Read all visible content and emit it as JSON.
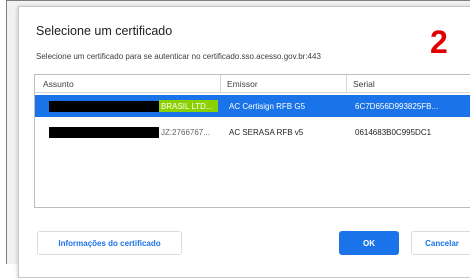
{
  "dialog": {
    "title": "Selecione um certificado",
    "subtitle": "Selecione um certificado para se autenticar no certificado.sso.acesso.gov.br:443",
    "step_number": "2"
  },
  "table": {
    "headers": [
      "Assunto",
      "Emissor",
      "Serial"
    ],
    "rows": [
      {
        "subject": "BRASIL LTD...",
        "issuer": "AC Certisign RFB G5",
        "serial": "6C7D656D993825FB...",
        "selected": true
      },
      {
        "subject": "JZ:2766767...",
        "issuer": "AC SERASA RFB v5",
        "serial": "0614683B0C995DC1",
        "selected": false
      }
    ]
  },
  "buttons": {
    "info": "Informações do certificado",
    "ok": "OK",
    "cancel": "Cancelar"
  },
  "colors": {
    "accent": "#1a73e8",
    "step_number": "#e00000",
    "redaction": "#000000",
    "highlight": "#8bd000"
  }
}
